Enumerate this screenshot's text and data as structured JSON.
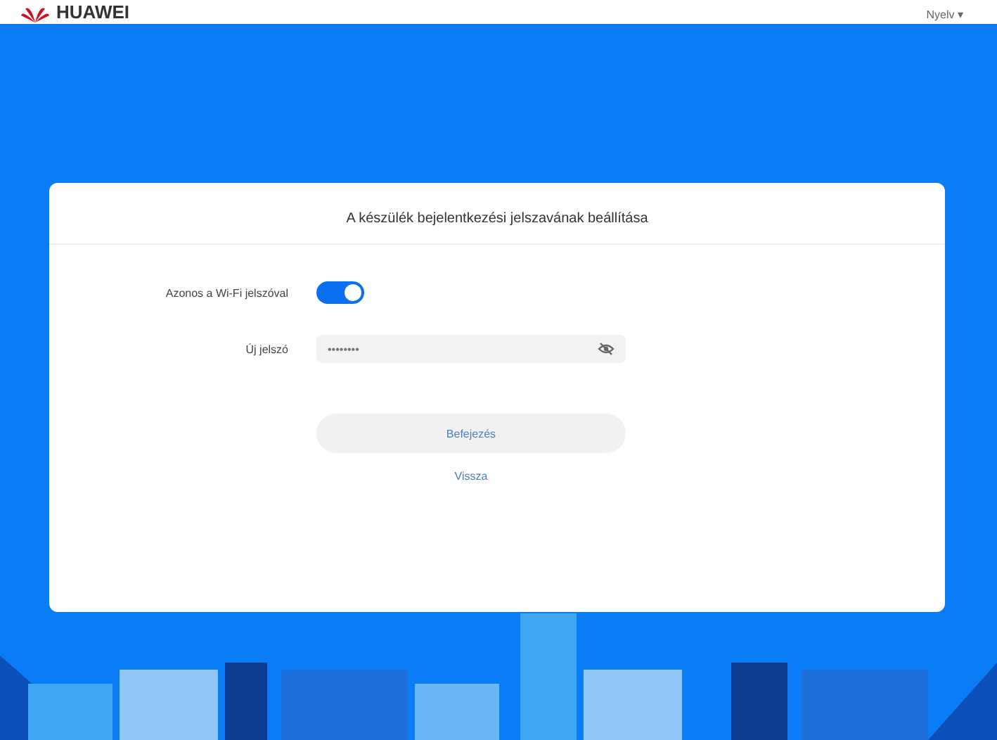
{
  "header": {
    "logo": "HUAWEI",
    "language": "Nyelv ▾"
  },
  "card": {
    "title": "A készülék bejelentkezési jelszavának beállítása",
    "same_as_wifi": {
      "label": "Azonos a Wi-Fi jelszóval",
      "on": true
    },
    "new_password": {
      "label": "Új jelszó",
      "placeholder": "••••••••"
    },
    "finish_button": "Befejezés",
    "back_link": "Vissza"
  }
}
